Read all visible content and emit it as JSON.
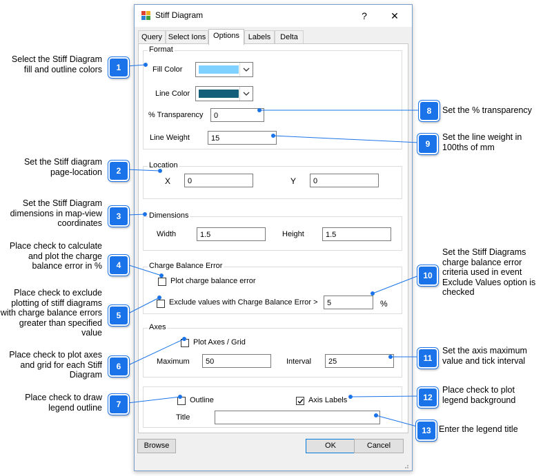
{
  "window": {
    "title": "Stiff Diagram",
    "help": "?",
    "close": "✕"
  },
  "tabs": [
    {
      "label": "Query"
    },
    {
      "label": "Select Ions"
    },
    {
      "label": "Options"
    },
    {
      "label": "Labels"
    },
    {
      "label": "Delta"
    }
  ],
  "format": {
    "legend": "Format",
    "fill_color_label": "Fill Color",
    "fill_color": "#7fd1ff",
    "line_color_label": "Line Color",
    "line_color": "#145f7a",
    "transparency_label": "% Transparency",
    "transparency_value": "0",
    "line_weight_label": "Line Weight",
    "line_weight_value": "15"
  },
  "location": {
    "legend": "Location",
    "x_label": "X",
    "x_value": "0",
    "y_label": "Y",
    "y_value": "0"
  },
  "dimensions": {
    "legend": "Dimensions",
    "width_label": "Width",
    "width_value": "1.5",
    "height_label": "Height",
    "height_value": "1.5"
  },
  "charge_balance": {
    "legend": "Charge Balance Error",
    "plot_label": "Plot charge balance error",
    "plot_checked": false,
    "exclude_label": "Exclude values with Charge Balance Error >",
    "exclude_checked": false,
    "exclude_value": "5",
    "percent": "%"
  },
  "axes": {
    "legend": "Axes",
    "plot_axes_label": "Plot Axes / Grid",
    "plot_axes_checked": false,
    "maximum_label": "Maximum",
    "maximum_value": "50",
    "interval_label": "Interval",
    "interval_value": "25"
  },
  "legend_box": {
    "outline_label": "Outline",
    "outline_checked": false,
    "axis_labels_label": "Axis Labels",
    "axis_labels_checked": true,
    "title_label": "Title",
    "title_value": ""
  },
  "buttons": {
    "browse": "Browse",
    "ok": "OK",
    "cancel": "Cancel"
  },
  "callouts": [
    {
      "num": "1",
      "text": "Select the Stiff Diagram fill and outline colors"
    },
    {
      "num": "2",
      "text": "Set the Stiff diagram page-location"
    },
    {
      "num": "3",
      "text": "Set the Stiff Diagram dimensions in map-view coordinates"
    },
    {
      "num": "4",
      "text": "Place check to calculate and plot the charge balance error in %"
    },
    {
      "num": "5",
      "text": "Place check to exclude plotting of stiff diagrams with charge balance errors greater than specified value"
    },
    {
      "num": "6",
      "text": "Place check to plot axes and grid for each Stiff Diagram"
    },
    {
      "num": "7",
      "text": "Place check to draw legend outline"
    },
    {
      "num": "8",
      "text": "Set the % transparency"
    },
    {
      "num": "9",
      "text": "Set the line weight in 100ths of mm"
    },
    {
      "num": "10",
      "text": "Set the Stiff Diagrams charge balance error criteria used in event Exclude Values option is checked"
    },
    {
      "num": "11",
      "text": "Set the axis maximum value and tick interval"
    },
    {
      "num": "12",
      "text": "Place check to plot legend background"
    },
    {
      "num": "13",
      "text": "Enter the legend title"
    }
  ],
  "colors": {
    "callout_blue": "#1a73e8",
    "window_border": "#7a9ccc",
    "primary_button_border": "#0078d7"
  }
}
